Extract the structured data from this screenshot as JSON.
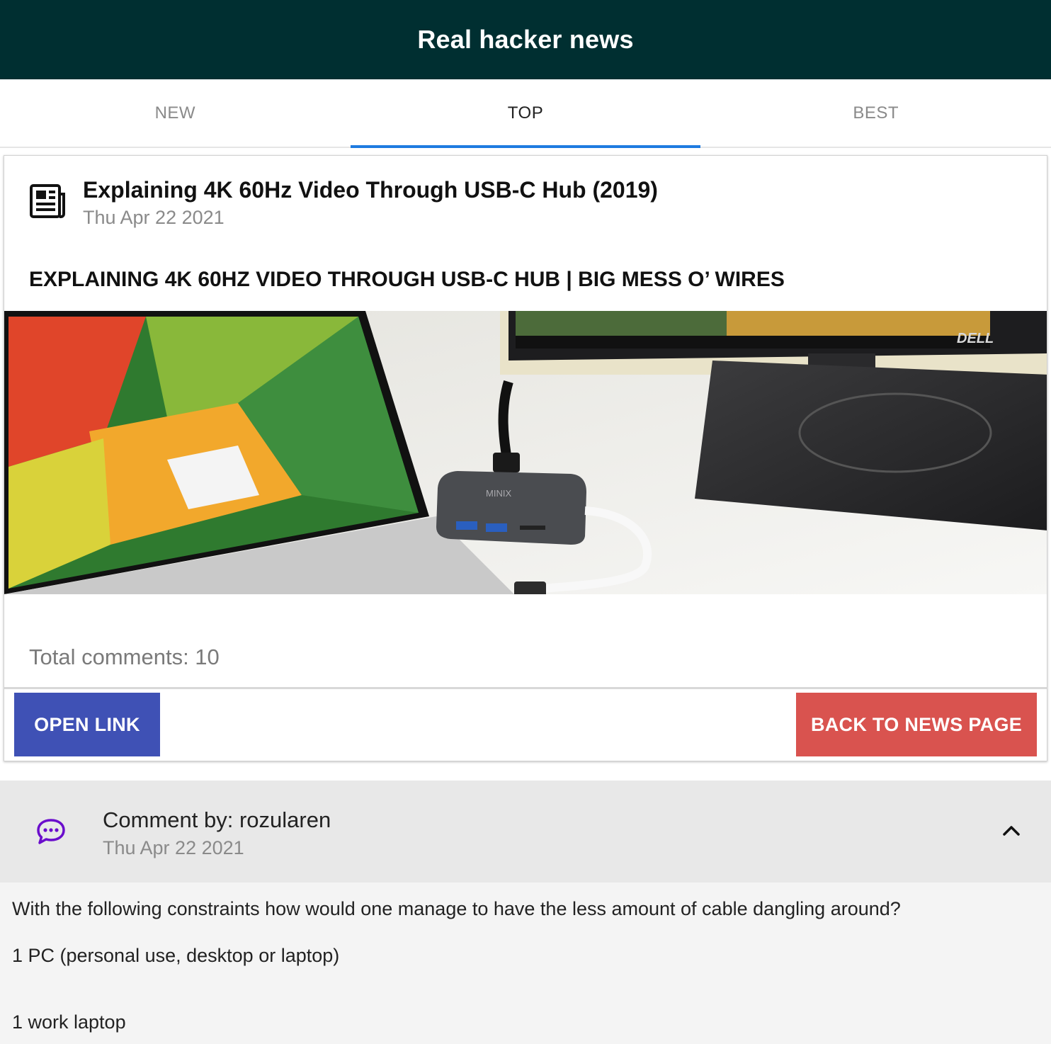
{
  "app": {
    "title": "Real hacker news"
  },
  "tabs": [
    {
      "label": "NEW",
      "active": false
    },
    {
      "label": "TOP",
      "active": true
    },
    {
      "label": "BEST",
      "active": false
    }
  ],
  "story": {
    "icon": "newspaper-icon",
    "title": "Explaining 4K 60Hz Video Through USB-C Hub (2019)",
    "date": "Thu Apr 22 2021",
    "link_title": "EXPLAINING 4K 60HZ VIDEO THROUGH USB-C HUB | BIG MESS O’ WIRES",
    "image": {
      "monitor_brand": "DELL",
      "hub_brand": "MINIX"
    },
    "total_comments": "Total comments: 10",
    "open_link_label": "OPEN LINK",
    "back_label": "BACK TO NEWS PAGE"
  },
  "comment": {
    "icon": "chat-bubble-icon",
    "expand_icon": "chevron-up-icon",
    "by": "Comment by: rozularen",
    "date": "Thu Apr 22 2021",
    "lines": [
      "With the following constraints how would one manage to have the less amount of cable dangling around?",
      "1 PC (personal use, desktop or laptop)",
      "1 work laptop"
    ]
  },
  "colors": {
    "appbar": "#002f31",
    "tab_indicator": "#1e7be0",
    "open_button": "#3f51b5",
    "back_button": "#d9534f",
    "chat_icon": "#6a0dcc"
  }
}
